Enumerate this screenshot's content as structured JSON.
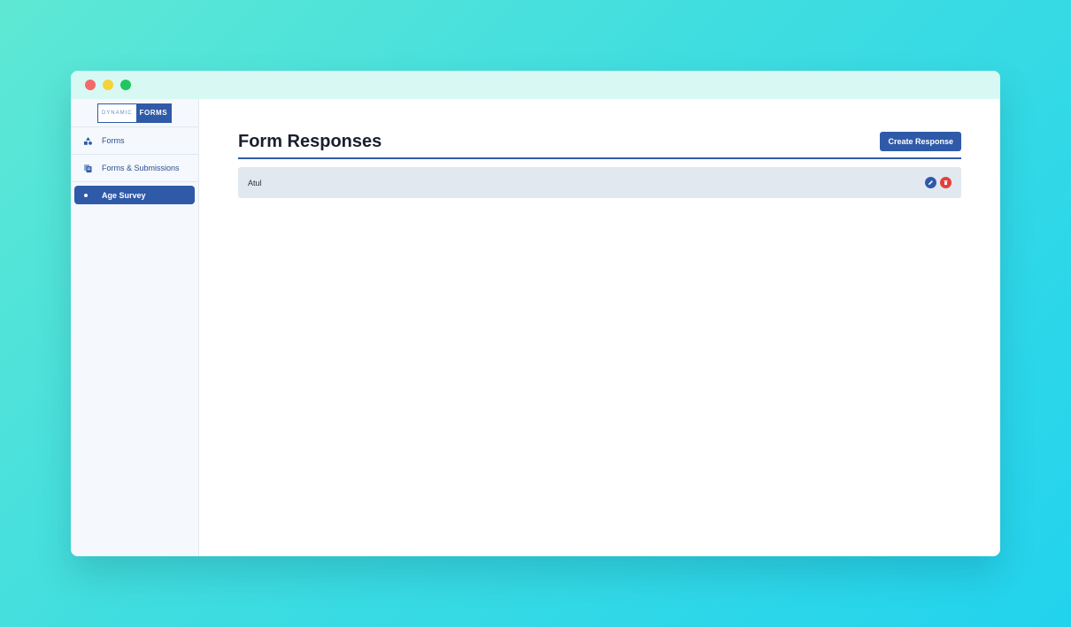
{
  "window": {
    "controls": [
      "close",
      "minimize",
      "maximize"
    ]
  },
  "sidebar": {
    "logo": {
      "left": "DYNAMIC",
      "right": "FORMS"
    },
    "items": [
      {
        "label": "Forms",
        "icon": "shapes-icon"
      },
      {
        "label": "Forms & Submissions",
        "icon": "documents-icon"
      }
    ],
    "active_item": {
      "label": "Age Survey",
      "icon": "bullet-icon"
    }
  },
  "main": {
    "title": "Form Responses",
    "create_button": "Create Response",
    "responses": [
      {
        "name": "Atul"
      }
    ]
  },
  "colors": {
    "accent": "#2f5aa8",
    "danger": "#e53e3e",
    "titlebar": "#d8f8f4",
    "sidebar_bg": "#f5f8fc",
    "row_bg": "#e2e8f0"
  }
}
